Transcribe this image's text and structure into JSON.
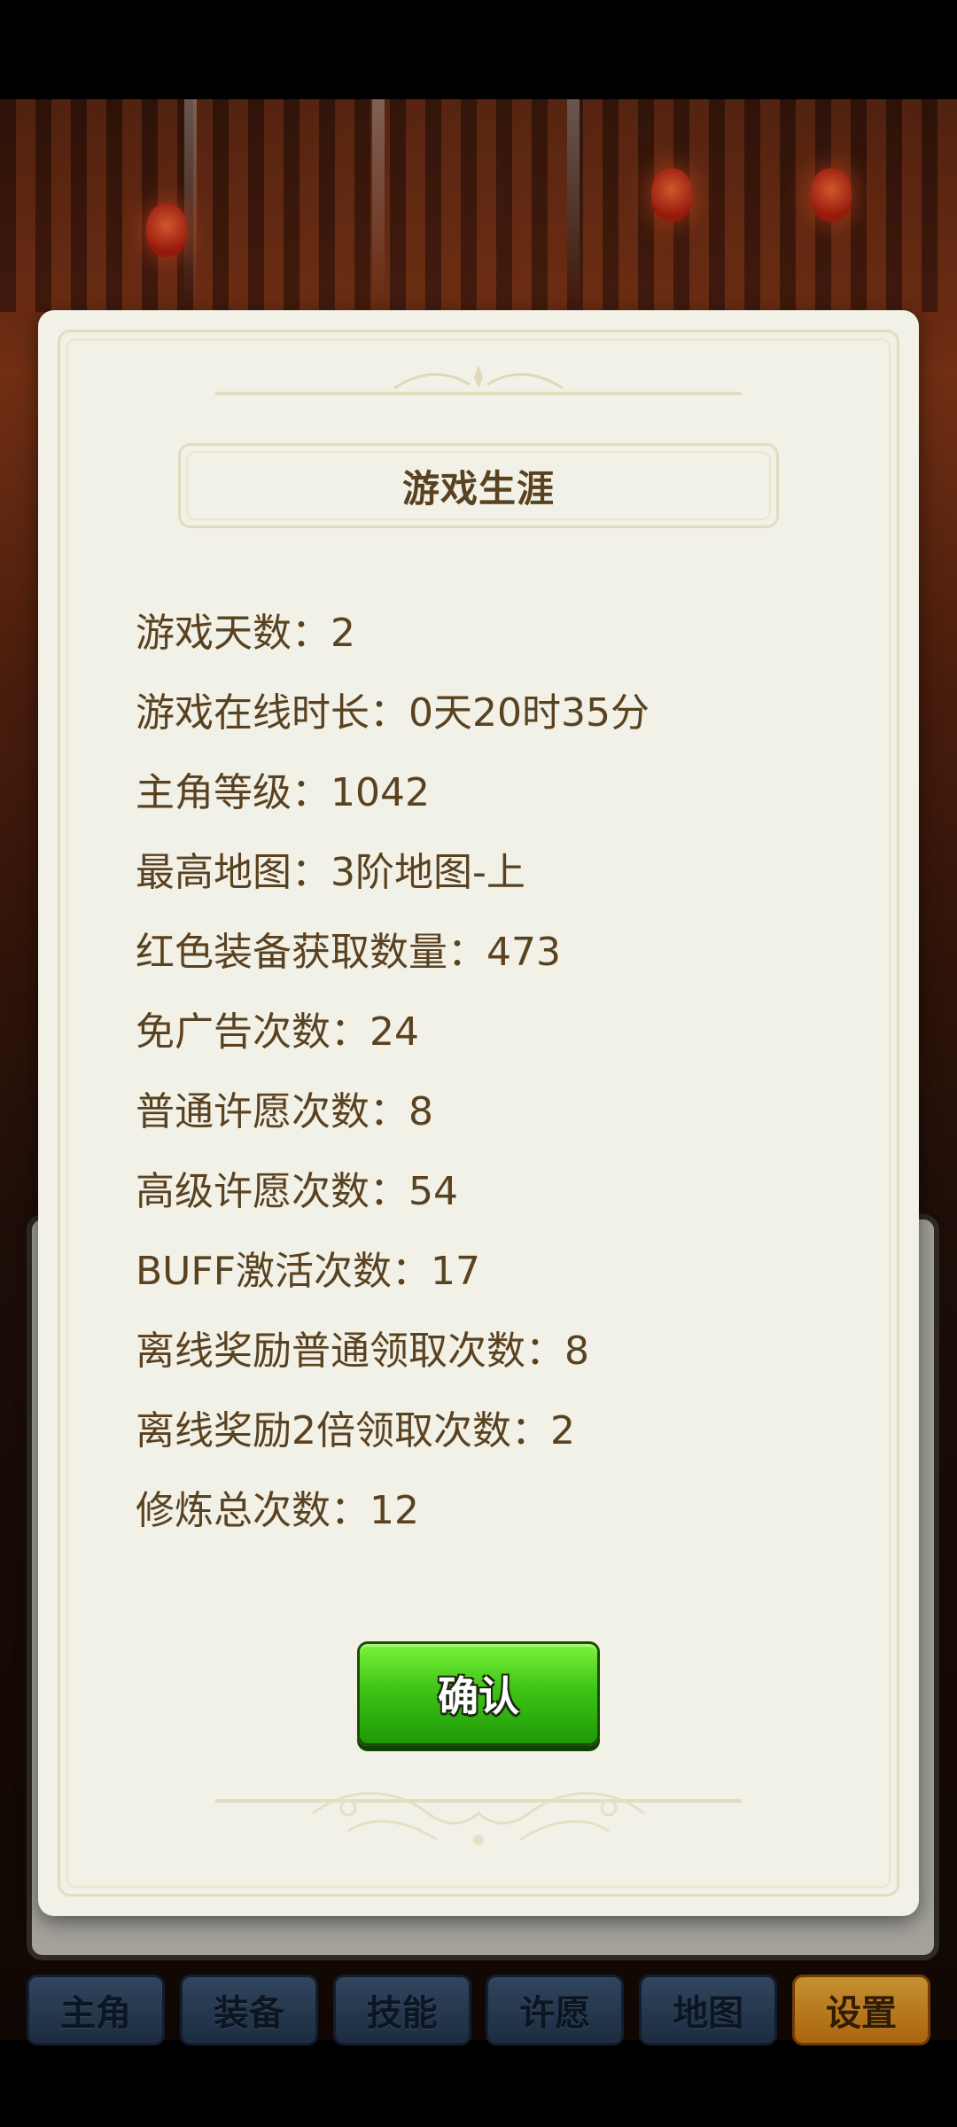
{
  "dialog": {
    "title": "游戏生涯",
    "stats": [
      "游戏天数：2",
      "游戏在线时长：0天20时35分",
      "主角等级：1042",
      "最高地图：3阶地图-上",
      "红色装备获取数量：473",
      "免广告次数：24",
      "普通许愿次数：8",
      "高级许愿次数：54",
      "BUFF激活次数：17",
      "离线奖励普通领取次数：8",
      "离线奖励2倍领取次数：2",
      "修炼总次数：12"
    ],
    "confirm_label": "确认"
  },
  "tabbar": {
    "tabs": [
      "主角",
      "装备",
      "技能",
      "许愿",
      "地图",
      "设置"
    ],
    "active": "设置"
  },
  "colors": {
    "dialog_bg": "#f2f1e7",
    "text": "#5a4221",
    "confirm_green": "#3fc416",
    "tab_blue": "#2f4663",
    "tab_active_orange": "#e6971f"
  }
}
